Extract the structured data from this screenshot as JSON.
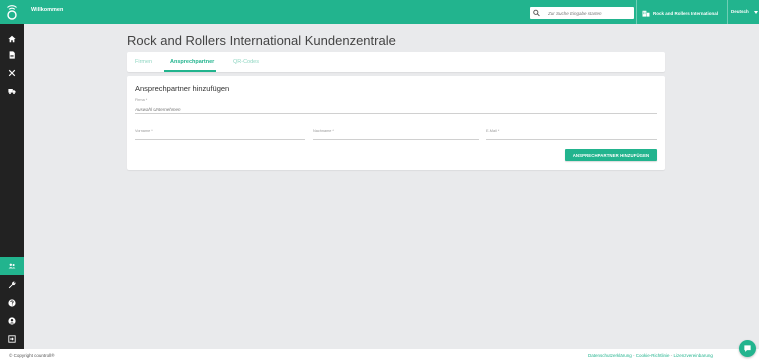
{
  "header": {
    "welcome": "Willkommen",
    "search_placeholder": "Zur Suche Eingabe starten",
    "company": "Rock and Rollers International",
    "language": "Deutsch"
  },
  "page": {
    "title": "Rock and Rollers International Kundenzentrale"
  },
  "tabs": [
    {
      "label": "Firmen",
      "active": false
    },
    {
      "label": "Ansprechpartner",
      "active": true
    },
    {
      "label": "QR-Codes",
      "active": false
    }
  ],
  "form": {
    "title": "Ansprechpartner hinzufügen",
    "firma_label": "Firma *",
    "firma_placeholder": "Auswahl Unternehmen",
    "vorname_label": "Vorname *",
    "nachname_label": "Nachname *",
    "email_label": "E-Mail *",
    "submit_label": "ANSPRECHPARTNER HINZUFÜGEN"
  },
  "sidebar": {
    "items": [
      {
        "icon": "home-icon"
      },
      {
        "icon": "document-icon"
      },
      {
        "icon": "tools-icon"
      },
      {
        "icon": "truck-icon"
      },
      {
        "icon": "users-icon",
        "active": true
      },
      {
        "icon": "wrench-icon"
      },
      {
        "icon": "help-icon"
      },
      {
        "icon": "account-icon"
      },
      {
        "icon": "logout-icon"
      }
    ]
  },
  "footer": {
    "copyright": "© Copyright countroll®",
    "link_privacy": "Datenschutzerklärung",
    "link_cookie": "Cookie-Richtlinie",
    "link_license": "Lizenzvereinbarung",
    "separator": " - "
  },
  "colors": {
    "accent": "#22b48e",
    "sidebar": "#222222",
    "background": "#e9eaec"
  }
}
